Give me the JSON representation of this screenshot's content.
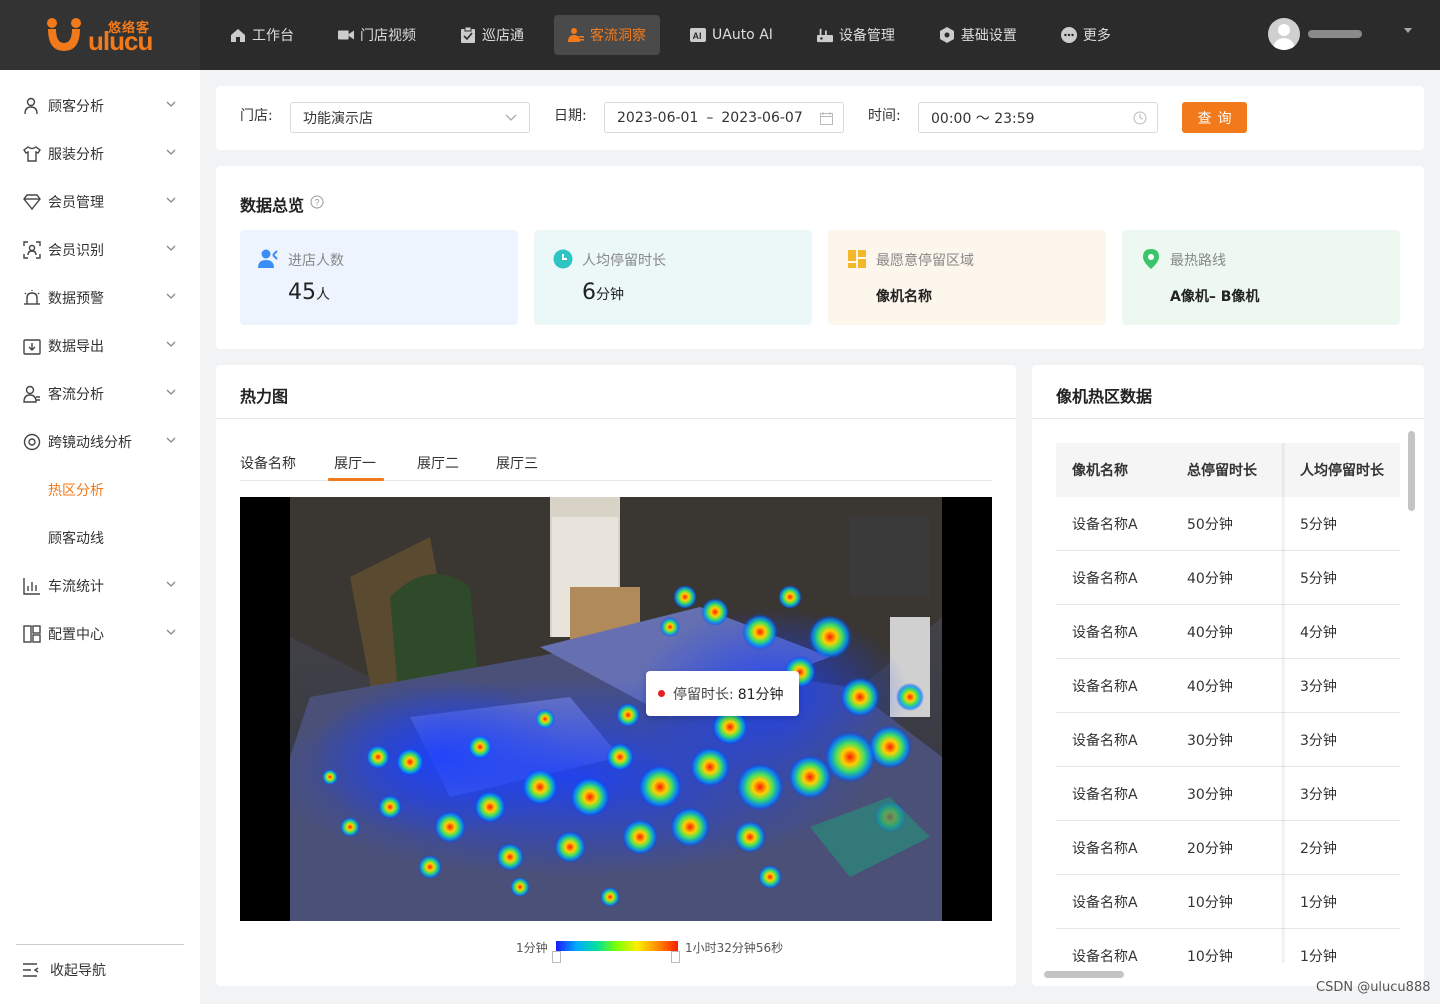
{
  "brand": {
    "cn": "悠络客",
    "en": "ulucu"
  },
  "nav": {
    "items": [
      {
        "label": "工作台",
        "icon": "home-icon"
      },
      {
        "label": "门店视频",
        "icon": "video-icon"
      },
      {
        "label": "巡店通",
        "icon": "clipboard-icon"
      },
      {
        "label": "客流洞察",
        "icon": "people-icon",
        "active": true
      },
      {
        "label": "UAuto AI",
        "icon": "ai-icon"
      },
      {
        "label": "设备管理",
        "icon": "device-icon"
      },
      {
        "label": "基础设置",
        "icon": "settings-icon"
      },
      {
        "label": "更多",
        "icon": "more-icon"
      }
    ]
  },
  "sidebar": {
    "items": [
      {
        "label": "顾客分析"
      },
      {
        "label": "服装分析"
      },
      {
        "label": "会员管理"
      },
      {
        "label": "会员识别"
      },
      {
        "label": "数据预警"
      },
      {
        "label": "数据导出"
      },
      {
        "label": "客流分析"
      },
      {
        "label": "跨镜动线分析"
      },
      {
        "label": "车流统计"
      },
      {
        "label": "配置中心"
      }
    ],
    "sub_items": [
      {
        "label": "热区分析",
        "active": true
      },
      {
        "label": "顾客动线"
      }
    ],
    "collapse_label": "收起导航"
  },
  "filter": {
    "store_label": "门店:",
    "store_value": "功能演示店",
    "date_label": "日期:",
    "date_start": "2023-06-01",
    "date_sep": "–",
    "date_end": "2023-06-07",
    "time_label": "时间:",
    "time_value": "00:00 ～ 23:59",
    "query_label": "查询"
  },
  "overview": {
    "title": "数据总览",
    "stats": [
      {
        "label": "进店人数",
        "value": "45",
        "unit": "人",
        "bg": "#eef4fe",
        "icon": "visitor-icon"
      },
      {
        "label": "人均停留时长",
        "value": "6",
        "unit": "分钟",
        "bg": "#ecf8f8",
        "icon": "clock-icon"
      },
      {
        "label": "最愿意停留区域",
        "value": "像机名称",
        "unit": "",
        "bg": "#fdf6ec",
        "icon": "area-icon"
      },
      {
        "label": "最热路线",
        "value": "A像机– B像机",
        "unit": "",
        "bg": "#ecf8f0",
        "icon": "route-icon"
      }
    ]
  },
  "heatmap": {
    "title": "热力图",
    "device_label": "设备名称",
    "tabs": [
      "展厅一",
      "展厅二",
      "展厅三"
    ],
    "active_tab": 0,
    "tooltip_label": "停留时长:",
    "tooltip_value": "81分钟",
    "legend_min": "1分钟",
    "legend_max": "1小时32分钟56秒"
  },
  "camera_table": {
    "title": "像机热区数据",
    "columns": [
      "像机名称",
      "总停留时长",
      "人均停留时长"
    ],
    "rows": [
      [
        "设备名称A",
        "50分钟",
        "5分钟"
      ],
      [
        "设备名称A",
        "40分钟",
        "5分钟"
      ],
      [
        "设备名称A",
        "40分钟",
        "4分钟"
      ],
      [
        "设备名称A",
        "40分钟",
        "3分钟"
      ],
      [
        "设备名称A",
        "30分钟",
        "3分钟"
      ],
      [
        "设备名称A",
        "30分钟",
        "3分钟"
      ],
      [
        "设备名称A",
        "20分钟",
        "2分钟"
      ],
      [
        "设备名称A",
        "10分钟",
        "1分钟"
      ],
      [
        "设备名称A",
        "10分钟",
        "1分钟"
      ]
    ]
  },
  "accent_color": "#f27a1a",
  "watermark": "CSDN @ulucu888"
}
